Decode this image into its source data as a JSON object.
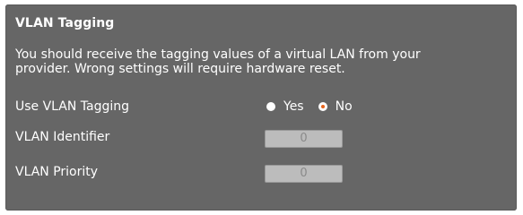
{
  "section": {
    "title": "VLAN Tagging",
    "description_line1": "You should receive the tagging values of a virtual LAN from your",
    "description_line2": "provider. Wrong settings will require hardware reset."
  },
  "use_vlan_tagging": {
    "label": "Use VLAN Tagging",
    "options": [
      {
        "label": "Yes",
        "selected": false
      },
      {
        "label": "No",
        "selected": true
      }
    ]
  },
  "vlan_identifier": {
    "label": "VLAN Identifier",
    "value": "0"
  },
  "vlan_priority": {
    "label": "VLAN Priority",
    "value": "0"
  },
  "colors": {
    "panel_background": "#666666",
    "text": "#ffffff",
    "radio_selected_accent": "#e8641b",
    "input_background": "#bcbcbc"
  }
}
